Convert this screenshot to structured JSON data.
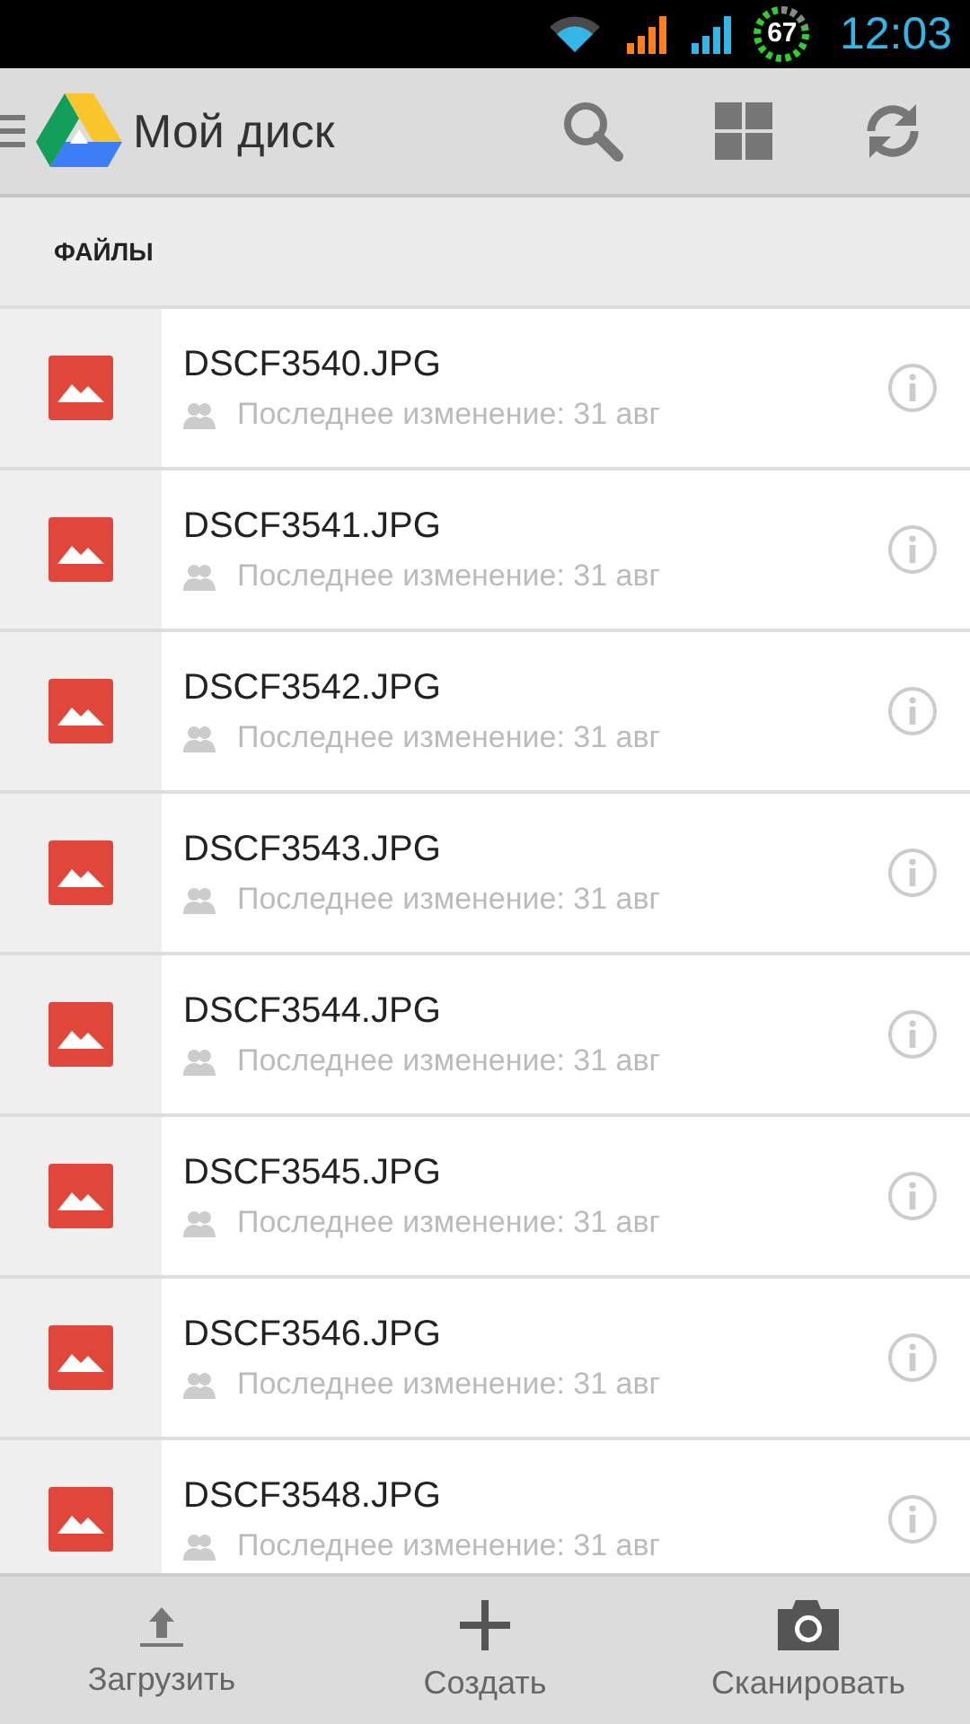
{
  "status_bar": {
    "battery": "67",
    "time": "12:03"
  },
  "toolbar": {
    "title": "Мой диск",
    "actions": [
      {
        "kind": "search"
      },
      {
        "kind": "grid"
      },
      {
        "kind": "refresh"
      }
    ]
  },
  "section": {
    "title": "ФАЙЛЫ"
  },
  "files": [
    {
      "name": "DSCF3540.JPG",
      "meta": "Последнее изменение: 31 авг"
    },
    {
      "name": "DSCF3541.JPG",
      "meta": "Последнее изменение: 31 авг"
    },
    {
      "name": "DSCF3542.JPG",
      "meta": "Последнее изменение: 31 авг"
    },
    {
      "name": "DSCF3543.JPG",
      "meta": "Последнее изменение: 31 авг"
    },
    {
      "name": "DSCF3544.JPG",
      "meta": "Последнее изменение: 31 авг"
    },
    {
      "name": "DSCF3545.JPG",
      "meta": "Последнее изменение: 31 авг"
    },
    {
      "name": "DSCF3546.JPG",
      "meta": "Последнее изменение: 31 авг"
    },
    {
      "name": "DSCF3548.JPG",
      "meta": "Последнее изменение: 31 авг"
    }
  ],
  "bottom_bar": [
    {
      "kind": "upload",
      "label": "Загрузить"
    },
    {
      "kind": "create",
      "label": "Создать"
    },
    {
      "kind": "scan",
      "label": "Сканировать"
    }
  ]
}
